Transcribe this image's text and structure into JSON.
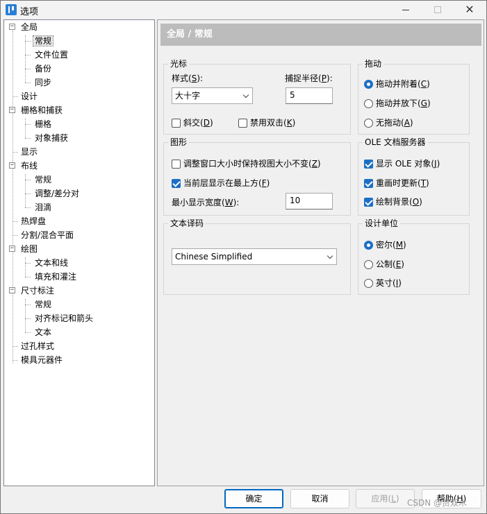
{
  "window": {
    "title": "选项"
  },
  "tree": {
    "items": [
      {
        "label": "全局",
        "level": 0,
        "expander": "−"
      },
      {
        "label": "常规",
        "level": 1,
        "selected": true
      },
      {
        "label": "文件位置",
        "level": 1
      },
      {
        "label": "备份",
        "level": 1
      },
      {
        "label": "同步",
        "level": 1
      },
      {
        "label": "设计",
        "level": 0
      },
      {
        "label": "栅格和捕获",
        "level": 0,
        "expander": "−"
      },
      {
        "label": "栅格",
        "level": 1
      },
      {
        "label": "对象捕获",
        "level": 1
      },
      {
        "label": "显示",
        "level": 0
      },
      {
        "label": "布线",
        "level": 0,
        "expander": "−"
      },
      {
        "label": "常规",
        "level": 1
      },
      {
        "label": "调整/差分对",
        "level": 1
      },
      {
        "label": "泪滴",
        "level": 1
      },
      {
        "label": "热焊盘",
        "level": 0
      },
      {
        "label": "分割/混合平面",
        "level": 0
      },
      {
        "label": "绘图",
        "level": 0,
        "expander": "−"
      },
      {
        "label": "文本和线",
        "level": 1
      },
      {
        "label": "填充和灌注",
        "level": 1
      },
      {
        "label": "尺寸标注",
        "level": 0,
        "expander": "−"
      },
      {
        "label": "常规",
        "level": 1
      },
      {
        "label": "对齐标记和箭头",
        "level": 1
      },
      {
        "label": "文本",
        "level": 1
      },
      {
        "label": "过孔样式",
        "level": 0
      },
      {
        "label": "模具元器件",
        "level": 0
      }
    ]
  },
  "panel": {
    "header": "全局 / 常规",
    "cursor": {
      "title": "光标",
      "style_label": "样式(",
      "style_key": "S",
      "style_suffix": "):",
      "style_value": "大十字",
      "snap_label": "捕捉半径(",
      "snap_key": "P",
      "snap_suffix": "):",
      "snap_value": "5",
      "diagonal_label": "斜交(",
      "diagonal_key": "D",
      "diagonal_suffix": ")",
      "nodbl_label": "禁用双击(",
      "nodbl_key": "K",
      "nodbl_suffix": ")"
    },
    "drag": {
      "title": "拖动",
      "opt1": "拖动并附着(",
      "opt1_key": "C",
      "opt1_suffix": ")",
      "opt2": "拖动并放下(",
      "opt2_key": "G",
      "opt2_suffix": ")",
      "opt3": "无拖动(",
      "opt3_key": "A",
      "opt3_suffix": ")"
    },
    "graphics": {
      "title": "图形",
      "keep_label": "调整窗口大小时保持视图大小不变(",
      "keep_key": "Z",
      "keep_suffix": ")",
      "top_label": "当前层显示在最上方(",
      "top_key": "F",
      "top_suffix": ")",
      "minw_label": "最小显示宽度(",
      "minw_key": "W",
      "minw_suffix": "):",
      "minw_value": "10"
    },
    "ole": {
      "title": "OLE 文档服务器",
      "show_label": "显示 OLE 对象(",
      "show_key": "J",
      "show_suffix": ")",
      "redraw_label": "重画时更新(",
      "redraw_key": "T",
      "redraw_suffix": ")",
      "bg_label": "绘制背景(",
      "bg_key": "O",
      "bg_suffix": ")"
    },
    "encoding": {
      "title": "文本译码",
      "value": "Chinese Simplified"
    },
    "units": {
      "title": "设计单位",
      "mil": "密尔(",
      "mil_key": "M",
      "mil_suffix": ")",
      "metric": "公制(",
      "metric_key": "E",
      "metric_suffix": ")",
      "inch": "英寸(",
      "inch_key": "I",
      "inch_suffix": ")"
    }
  },
  "buttons": {
    "ok": "确定",
    "cancel": "取消",
    "apply": "应用(",
    "apply_key": "L",
    "apply_suffix": ")",
    "help": "帮助(",
    "help_key": "H",
    "help_suffix": ")"
  },
  "watermark": "CSDN @贾双木"
}
